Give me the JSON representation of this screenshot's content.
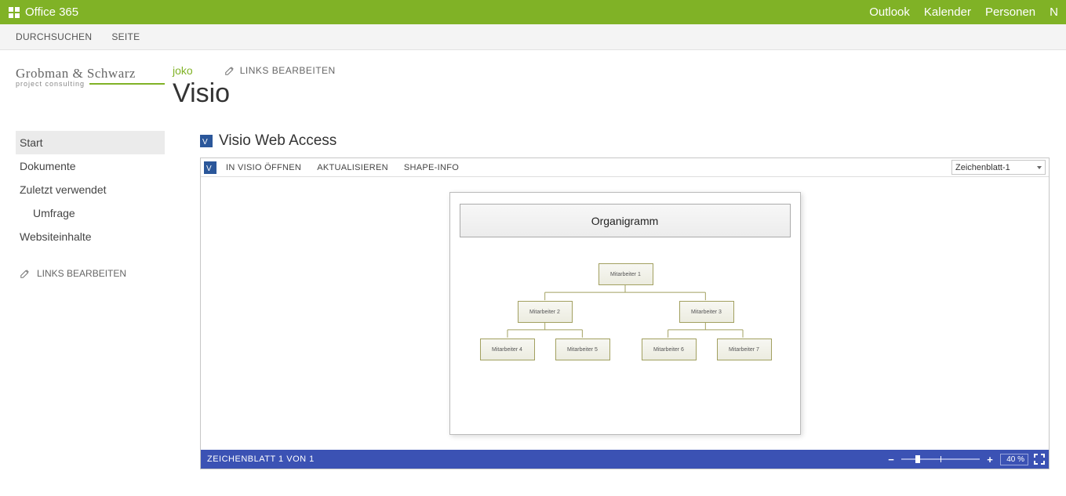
{
  "suite": {
    "product": "Office 365",
    "nav": [
      "Outlook",
      "Kalender",
      "Personen",
      "N"
    ]
  },
  "ribbon": {
    "tabs": [
      "DURCHSUCHEN",
      "SEITE"
    ]
  },
  "company": {
    "line1": "Grobman & Schwarz",
    "line2": "project consulting"
  },
  "sidebar": {
    "items": [
      {
        "label": "Start",
        "active": true,
        "indent": false
      },
      {
        "label": "Dokumente",
        "active": false,
        "indent": false
      },
      {
        "label": "Zuletzt verwendet",
        "active": false,
        "indent": false
      },
      {
        "label": "Umfrage",
        "active": false,
        "indent": true
      },
      {
        "label": "Websiteinhalte",
        "active": false,
        "indent": false
      }
    ],
    "edit_links": "LINKS BEARBEITEN"
  },
  "crumb": {
    "site": "joko",
    "edit_links": "LINKS BEARBEITEN"
  },
  "page": {
    "title": "Visio"
  },
  "webpart": {
    "title": "Visio Web Access"
  },
  "vwa": {
    "toolbar": {
      "open_in_visio": "IN VISIO ÖFFNEN",
      "refresh": "AKTUALISIEREN",
      "shape_info": "SHAPE-INFO"
    },
    "sheet_select": "Zeichenblatt-1",
    "diagram": {
      "title": "Organigramm",
      "nodes": {
        "n1": "Mitarbeiter 1",
        "n2": "Mitarbeiter 2",
        "n3": "Mitarbeiter 3",
        "n4": "Mitarbeiter 4",
        "n5": "Mitarbeiter 5",
        "n6": "Mitarbeiter 6",
        "n7": "Mitarbeiter 7"
      }
    },
    "status": {
      "sheet_info": "ZEICHENBLATT 1 VON 1",
      "zoom_pct": "40 %"
    }
  }
}
